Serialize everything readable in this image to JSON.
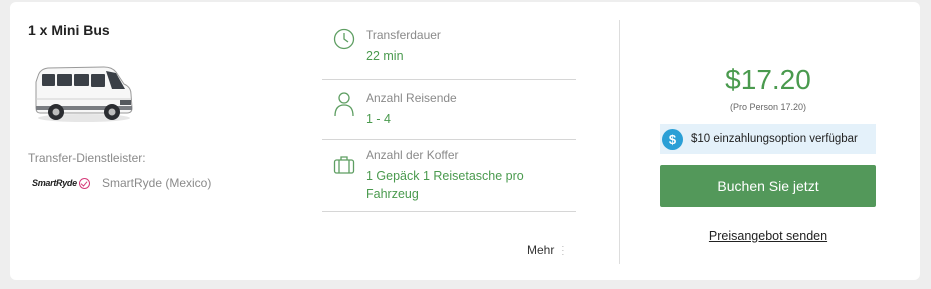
{
  "vehicle": {
    "title": "1 x Mini Bus",
    "image_icon": "minibus-van-image"
  },
  "provider": {
    "label": "Transfer-Dienstleister:",
    "logo_text": "SmartRyde",
    "name": "SmartRyde (Mexico)"
  },
  "details": [
    {
      "icon": "clock-icon",
      "label": "Transferdauer",
      "value": "22 min"
    },
    {
      "icon": "person-icon",
      "label": "Anzahl Reisende",
      "value": "1 - 4"
    },
    {
      "icon": "luggage-icon",
      "label": "Anzahl der Koffer",
      "value": "1 Gepäck 1 Reisetasche pro Fahrzeug"
    }
  ],
  "more": {
    "label": "Mehr",
    "icon": "vertical-dots-icon"
  },
  "pricing": {
    "price": "$17.20",
    "per_person": "(Pro Person 17.20)",
    "deposit_icon": "$",
    "deposit_text": "$10 einzahlungsoption verfügbar",
    "book_label": "Buchen Sie jetzt",
    "quote_link": "Preisangebot senden"
  },
  "colors": {
    "accent_green": "#4a9a4e",
    "button_green": "#53985a",
    "info_blue": "#2a9fd6",
    "deposit_bg": "#e4f1fa"
  }
}
